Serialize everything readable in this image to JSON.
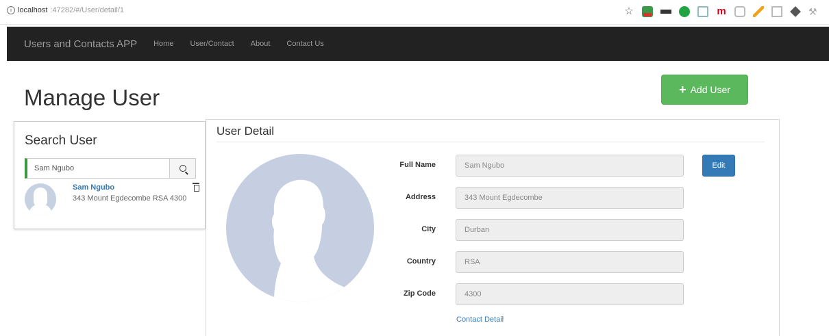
{
  "browser": {
    "url_host": "localhost",
    "url_path": ":47282/#/User/detail/1",
    "extension_icons": [
      "star-icon",
      "green-box-icon",
      "flag-icon",
      "check-icon",
      "doc-icon",
      "m-icon",
      "hex-icon",
      "pen-icon",
      "grid-icon",
      "eraser-icon",
      "wrench-icon"
    ]
  },
  "navbar": {
    "brand": "Users and Contacts APP",
    "links": [
      "Home",
      "User/Contact",
      "About",
      "Contact Us"
    ]
  },
  "page": {
    "title": "Manage User",
    "add_button": "Add User"
  },
  "search": {
    "title": "Search User",
    "input_value": "Sam Ngubo",
    "result": {
      "name": "Sam Ngubo",
      "address": "343 Mount Egdecombe RSA 4300"
    }
  },
  "detail": {
    "title": "User Detail",
    "fields": [
      {
        "label": "Full Name",
        "value": "Sam Ngubo"
      },
      {
        "label": "Address",
        "value": "343 Mount Egdecombe"
      },
      {
        "label": "City",
        "value": "Durban"
      },
      {
        "label": "Country",
        "value": "RSA"
      },
      {
        "label": "Zip Code",
        "value": "4300"
      }
    ],
    "edit_button": "Edit",
    "contact_link": "Contact Detail"
  },
  "colors": {
    "navbar_bg": "#222222",
    "success": "#5cb85c",
    "primary": "#337ab7",
    "avatar": "#c5cfe1"
  }
}
